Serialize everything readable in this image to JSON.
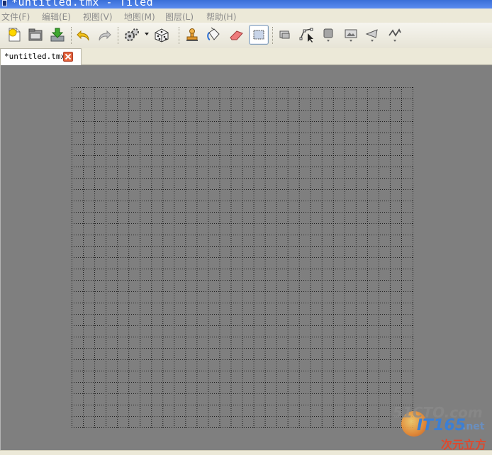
{
  "window": {
    "title": "*untitled.tmx - Tiled"
  },
  "menu": [
    {
      "label": "文件(F)"
    },
    {
      "label": "编辑(E)"
    },
    {
      "label": "视图(V)"
    },
    {
      "label": "地图(M)"
    },
    {
      "label": "图层(L)"
    },
    {
      "label": "帮助(H)"
    }
  ],
  "toolbar": {
    "tools": [
      {
        "icon": "new-file-icon"
      },
      {
        "icon": "open-folder-icon"
      },
      {
        "icon": "save-download-icon"
      },
      {
        "icon": "undo-icon"
      },
      {
        "icon": "redo-icon"
      },
      {
        "icon": "command-gears-icon",
        "has_dropdown": true
      },
      {
        "icon": "random-dice-icon"
      },
      {
        "icon": "stamp-brush-icon"
      },
      {
        "icon": "bucket-fill-icon"
      },
      {
        "icon": "eraser-icon"
      },
      {
        "icon": "rectangular-select-icon",
        "active": true
      },
      {
        "icon": "select-objects-icon"
      },
      {
        "icon": "edit-polygons-icon"
      },
      {
        "icon": "insert-rectangle-icon"
      },
      {
        "icon": "insert-image-icon"
      },
      {
        "icon": "insert-polygon-icon"
      },
      {
        "icon": "insert-polyline-icon"
      }
    ]
  },
  "tabs": [
    {
      "label": "*untitled.tmx",
      "active": true
    }
  ],
  "map": {
    "columns": 30,
    "rows": 30,
    "background": "#7f7f7f",
    "grid_color": "#1a1a1a"
  },
  "watermark": {
    "top": "51CTO.com",
    "brand": "IT165",
    "suffix": ".net",
    "tagline": "次元立方"
  }
}
